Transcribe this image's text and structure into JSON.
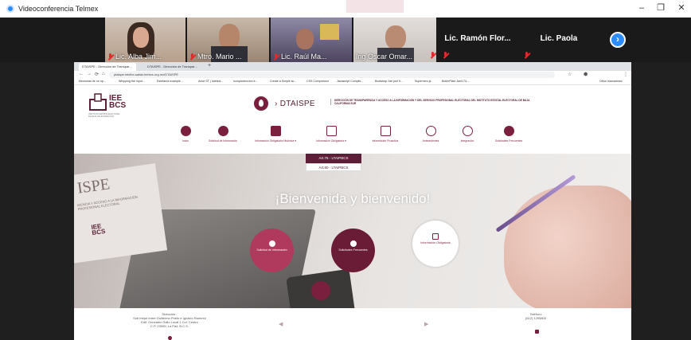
{
  "window": {
    "title": "Videoconferencia Telmex",
    "minimize": "–",
    "restore": "❐",
    "close": "✕"
  },
  "participants": [
    {
      "name": "Lic. Alba Jim..."
    },
    {
      "name": "Mtro. Mario ..."
    },
    {
      "name": "Lic. Raúl Ma..."
    },
    {
      "name": "Ing Oscar Omar..."
    }
  ],
  "participants_text": [
    {
      "name": "Lic. Ramón Flor..."
    },
    {
      "name": "Lic. Paola"
    }
  ],
  "next_page": "›",
  "browser": {
    "tabs": [
      {
        "label": "DTAISPE - Dirección de Transpar…"
      },
      {
        "label": "DTAISPE - Dirección de Transpar…"
      }
    ],
    "new_tab": "+",
    "url": "ptaispe.intelbc-saiskr.ieebcs.org.mx/DTAISPE",
    "bookmarks": [
      "Memorias de un op...",
      "Whipping the input...",
      "Estefanía example...",
      "Actor ST | Intelect...",
      "Iconpicoleccion.e...",
      "Create a Simple sc...",
      "CSS Compressor",
      "Javascript Compile...",
      "Bootstrap Jan just fr...",
      "Superhero.js",
      "BoilerPlate Jan/LT/L...",
      "Otros marcadores"
    ]
  },
  "site": {
    "logo_text": "IEE\nBCS",
    "logo_sub": "INSTITUTO ESTATAL ELECTORAL DE BAJA CALIFORNIA SUR",
    "brand": "› DTAISPE",
    "brand_desc": "DIRECCIÓN DE TRANSPARENCIA Y ACCESO A LA INFORMACIÓN Y DEL SERVICIO PROFESIONAL ELECTORAL DEL INSTITUTO ESTATAL ELECTORAL DE BAJA CALIFORNIA SUR",
    "menu": [
      "Inicio",
      "Solicitud de Información",
      "Información Obligatoria Histórica ▾",
      "Información Obligatoria ▾",
      "Información Proactiva",
      "Antecedentes",
      "Integración",
      "Solicitudes Frecuentes"
    ],
    "art_75": "Art.75 - LTAIPBCS",
    "art_80": "Art.80 - LTAIPBCS",
    "welcome": "¡Bienvenida y bienvenido!",
    "hero_circles": [
      {
        "label": "Solicitud de Información"
      },
      {
        "label": "Solicitudes Frecuentes"
      },
      {
        "label": "Información Obligatoria"
      }
    ],
    "hero_ispe": "ISPE",
    "hero_ispe_sub": "IGENCIA Y ACCESO A LA INFORMACIÓN PROFESIONAL ELECTORAL",
    "hero_iee": "IEE\nBCS",
    "footer": {
      "address_title": "Dirección :",
      "address_lines": [
        "Sub mejor entre Guillermo Prieto e Ignacio Ramírez",
        "Edif. Gonzalez Gallo Local 1 Col. Centro",
        "C.P. 23000, La Paz, B.C.S."
      ],
      "phone_title": "Teléfono",
      "phone": "(612) 1295800",
      "arrow_left": "◀",
      "arrow_right": "▶"
    }
  },
  "colors": {
    "brand": "#7a1f3d",
    "zoom_blue": "#2d8cff"
  }
}
